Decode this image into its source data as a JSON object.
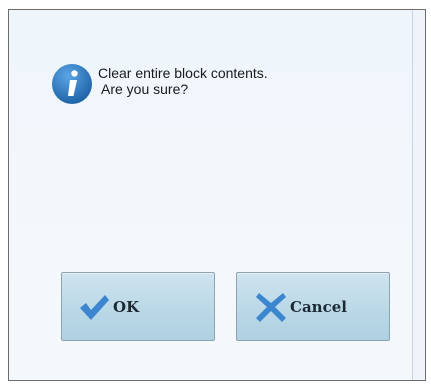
{
  "dialog": {
    "message_line1": "Clear entire block contents.",
    "message_line2": "Are you sure?",
    "icon": "info-icon"
  },
  "buttons": {
    "ok_label": "OK",
    "ok_icon": "checkmark-icon",
    "cancel_label": "Cancel",
    "cancel_icon": "x-icon"
  },
  "colors": {
    "icon_blue": "#2e7bbf",
    "button_fill": "#b9d7e6",
    "check_blue": "#3b86cf"
  }
}
